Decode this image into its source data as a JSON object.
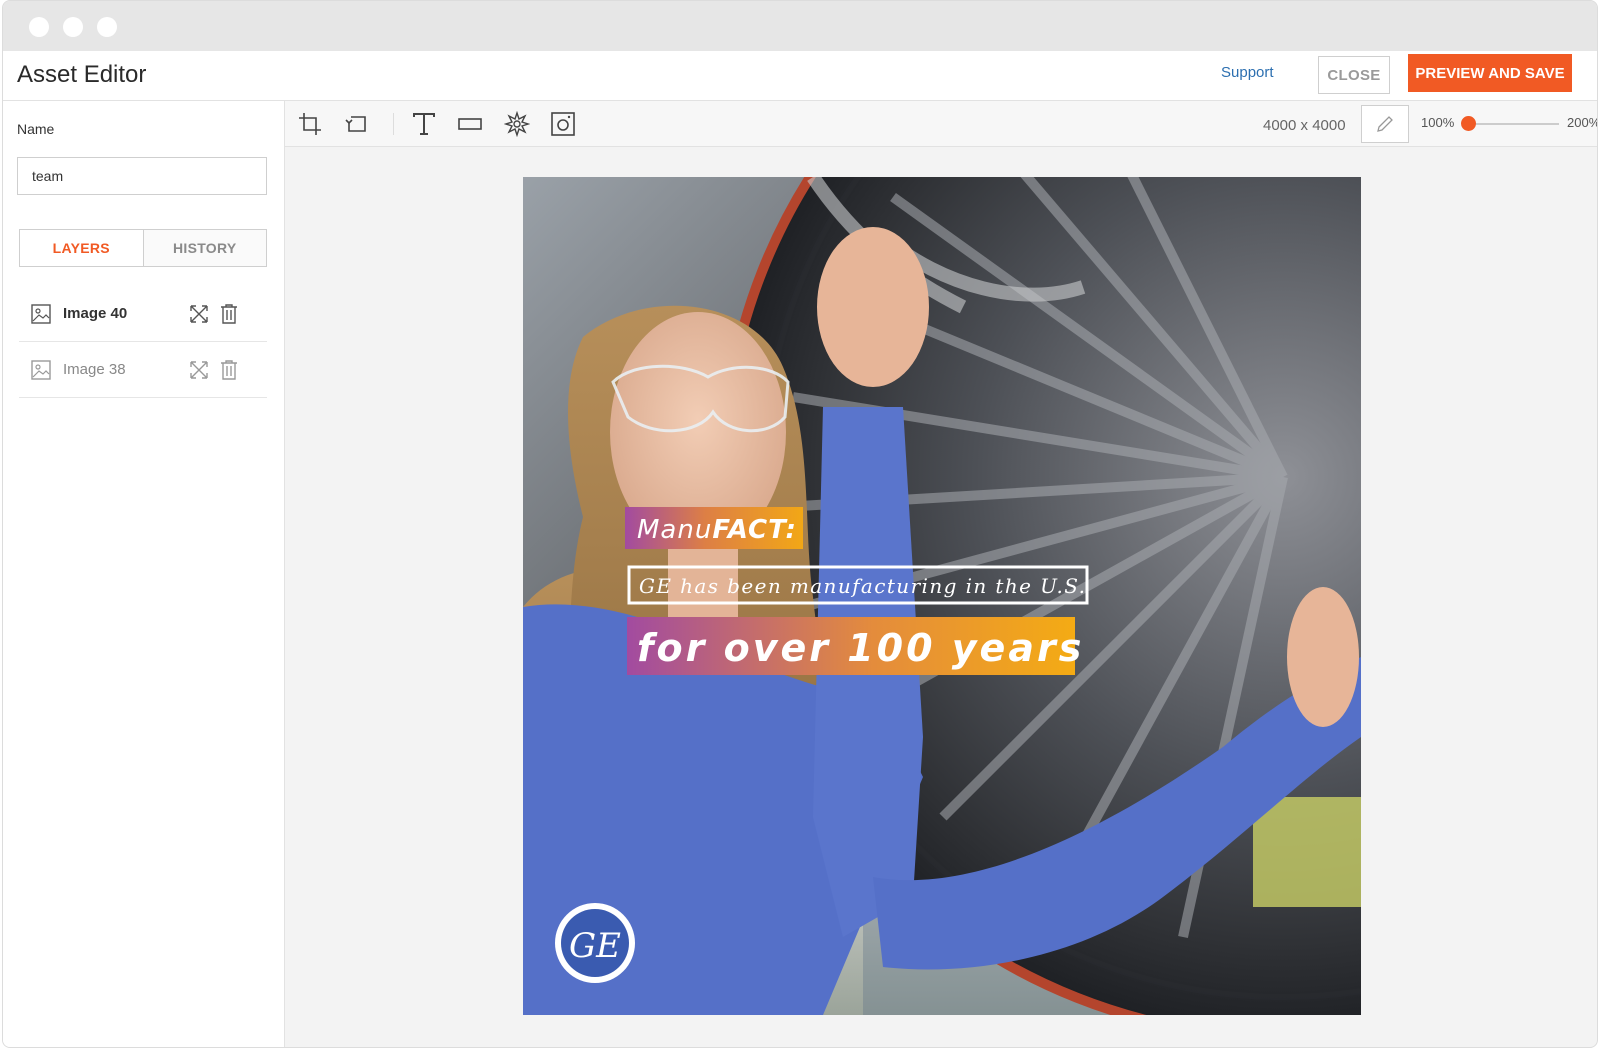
{
  "app": {
    "title": "Asset Editor"
  },
  "header": {
    "support": "Support",
    "close": "CLOSE",
    "preview_save": "PREVIEW AND SAVE"
  },
  "sidebar": {
    "name_label": "Name",
    "name_value": "team",
    "tabs": [
      {
        "label": "LAYERS",
        "active": true
      },
      {
        "label": "HISTORY",
        "active": false
      }
    ],
    "layers": [
      {
        "name": "Image 40",
        "selected": true
      },
      {
        "name": "Image 38",
        "selected": false
      }
    ]
  },
  "toolbar": {
    "tools": [
      "crop-icon",
      "rotate-icon",
      "text-icon",
      "rectangle-icon",
      "sticker-icon",
      "instagram-icon"
    ],
    "dimensions": "4000 x 4000",
    "zoom_min": "100%",
    "zoom_max": "200%",
    "zoom_level": 0
  },
  "canvas": {
    "headline_a": "Manu",
    "headline_b": "FACT:",
    "line2": "GE has been manufacturing in the U.S.",
    "line3": "for over 100 years",
    "logo_text": "GE"
  },
  "colors": {
    "accent": "#f15a24",
    "link": "#2c6fb0",
    "sweater": "#5570c8"
  }
}
